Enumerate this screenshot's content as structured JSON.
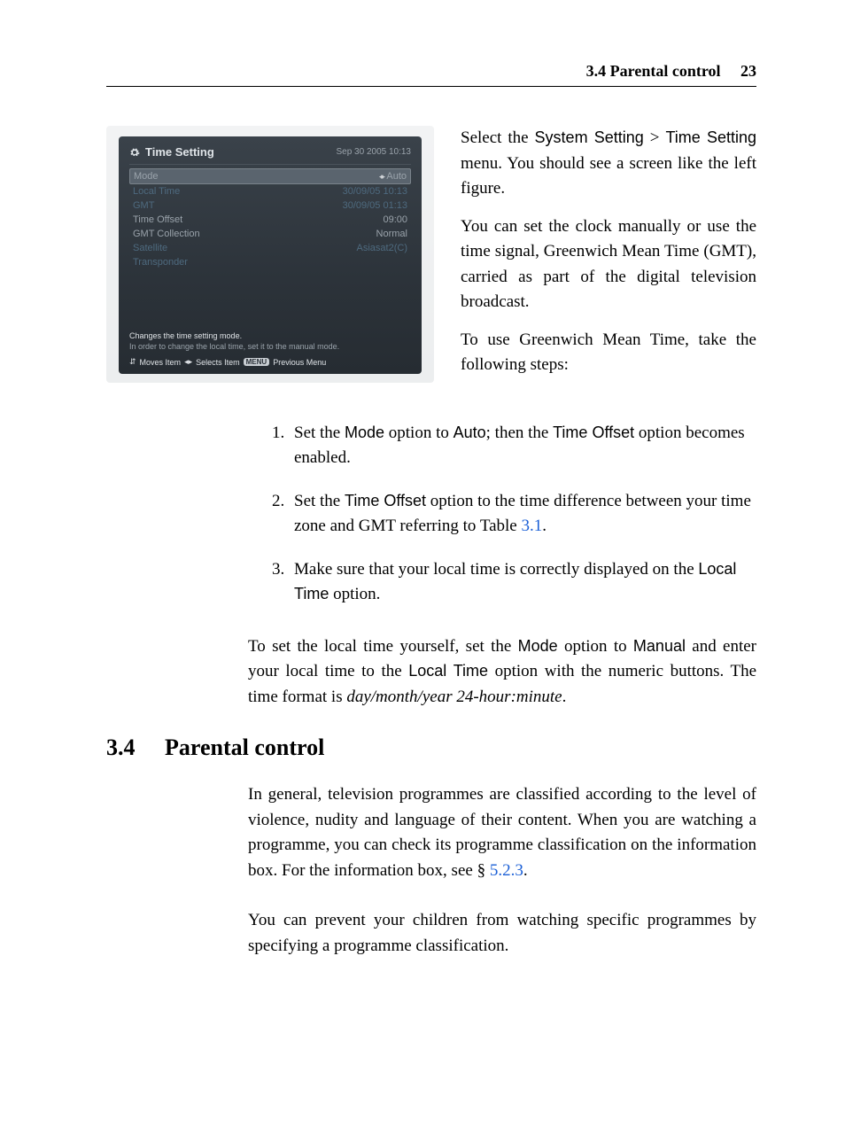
{
  "header": {
    "section_number": "3.4",
    "section_title": "Parental control",
    "page_number": "23"
  },
  "figure": {
    "title": "Time Setting",
    "datetime": "Sep 30 2005 10:13",
    "rows": [
      {
        "label": "Mode",
        "value": "Auto",
        "state": "selected"
      },
      {
        "label": "Local Time",
        "value": "30/09/05 10:13",
        "state": "dim"
      },
      {
        "label": "GMT",
        "value": "30/09/05 01:13",
        "state": "dim"
      },
      {
        "label": "Time Offset",
        "value": "09:00",
        "state": "normal"
      },
      {
        "label": "GMT Collection",
        "value": "Normal",
        "state": "normal"
      },
      {
        "label": "Satellite",
        "value": "Asiasat2(C)",
        "state": "dim"
      },
      {
        "label": "Transponder",
        "value": "",
        "state": "dim"
      }
    ],
    "hint_line1": "Changes the time setting mode.",
    "hint_line2": "In order to change the local time, set it to the manual mode.",
    "nav_moves": "Moves Item",
    "nav_selects": "Selects Item",
    "nav_menu_badge": "MENU",
    "nav_prev": "Previous Menu"
  },
  "side": {
    "p1a": "Select the ",
    "p1_sans1": "System Setting",
    "p1_gt": " > ",
    "p1_sans2": "Time Setting",
    "p1b": " menu. You should see a screen like the left figure.",
    "p2": "You can set the clock manually or use the time signal, Green­wich Mean Time (GMT), carried as part of the digital television broadcast.",
    "p3": "To use Greenwich Mean Time, take the following steps:"
  },
  "steps": {
    "s1a": "Set the ",
    "s1_sans1": "Mode",
    "s1b": " option to ",
    "s1_sans2": "Auto",
    "s1c": "; then the ",
    "s1_sans3": "Time Offset",
    "s1d": " option becomes enabled.",
    "s2a": "Set the ",
    "s2_sans1": "Time Offset",
    "s2b": " option to the time difference between your time zone and GMT referring to Table ",
    "s2_link": "3.1",
    "s2c": ".",
    "s3a": "Make sure that your local time is correctly displayed on the ",
    "s3_sans1": "Local Time",
    "s3b": " option."
  },
  "para_manual": {
    "a": "To set the local time yourself, set the ",
    "sans1": "Mode",
    "b": " option to ",
    "sans2": "Manual",
    "c": " and enter your local time to the ",
    "sans3": "Local Time",
    "d": " option with the numeric buttons. The time format is ",
    "ital": "day/month/year 24-hour:minute",
    "e": "."
  },
  "section": {
    "num": "3.4",
    "title": "Parental control"
  },
  "parental": {
    "p1a": "In general, television programmes are classified according to the level of violence, nudity and language of their content. When you are watching a programme, you can check its pro­gramme classification on the information box. For the informa­tion box, see § ",
    "p1_link": "5.2.3",
    "p1b": ".",
    "p2": "You can prevent your children from watching specific pro­grammes by specifying a programme classification."
  }
}
